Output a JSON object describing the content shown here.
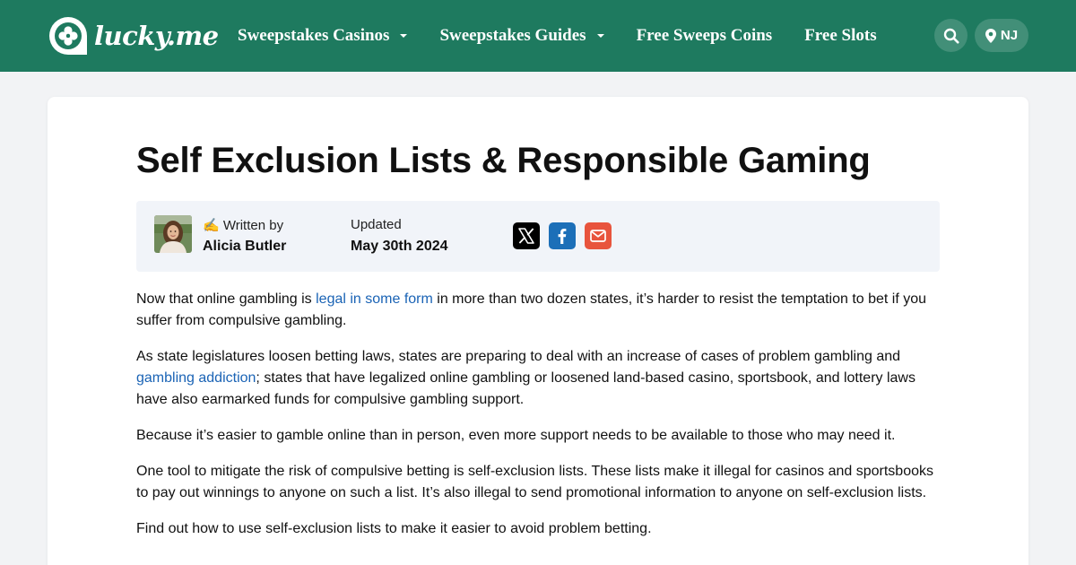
{
  "header": {
    "logo_text": "lucky.me",
    "nav": [
      {
        "label": "Sweepstakes Casinos",
        "has_dropdown": true
      },
      {
        "label": "Sweepstakes Guides",
        "has_dropdown": true
      },
      {
        "label": "Free Sweeps Coins",
        "has_dropdown": false
      },
      {
        "label": "Free Slots",
        "has_dropdown": false
      }
    ],
    "search_icon": "search-icon",
    "state": {
      "icon": "map-pin-icon",
      "label": "NJ"
    }
  },
  "article": {
    "title": "Self Exclusion Lists & Responsible Gaming",
    "meta": {
      "author_label": "✍ Written by",
      "author_name": "Alicia Butler",
      "updated_label": " Updated",
      "updated_date": "May 30th 2024",
      "share": [
        {
          "icon": "x-twitter-icon",
          "color": "#000000"
        },
        {
          "icon": "facebook-icon",
          "color": "#1c6fb8"
        },
        {
          "icon": "email-icon",
          "color": "#e8543d"
        }
      ]
    },
    "paragraphs": {
      "p1_a": "Now that online gambling is ",
      "p1_link": "legal in some form",
      "p1_b": " in more than two dozen states, it’s harder to resist the temptation to bet if you suffer from compulsive gambling.",
      "p2_a": "As state legislatures loosen betting laws, states are preparing to deal with an increase of cases of problem gambling and ",
      "p2_link": "gambling addiction",
      "p2_b": "; states that have legalized online gambling or loosened land-based casino, sportsbook, and lottery laws have also earmarked funds for compulsive gambling support.",
      "p3": "Because it’s easier to gamble online than in person, even more support needs to be available to those who may need it.",
      "p4": "One tool to mitigate the risk of compulsive betting is self-exclusion lists. These lists make it illegal for casinos and sportsbooks to pay out winnings to anyone on such a list. It’s also illegal to send promotional information to anyone on self-exclusion lists.",
      "p5": "Find out how to use self-exclusion lists to make it easier to avoid problem betting."
    }
  },
  "colors": {
    "brand_green": "#1e7a5f",
    "link_blue": "#1a63b5",
    "meta_bg": "#f1f4f9"
  }
}
